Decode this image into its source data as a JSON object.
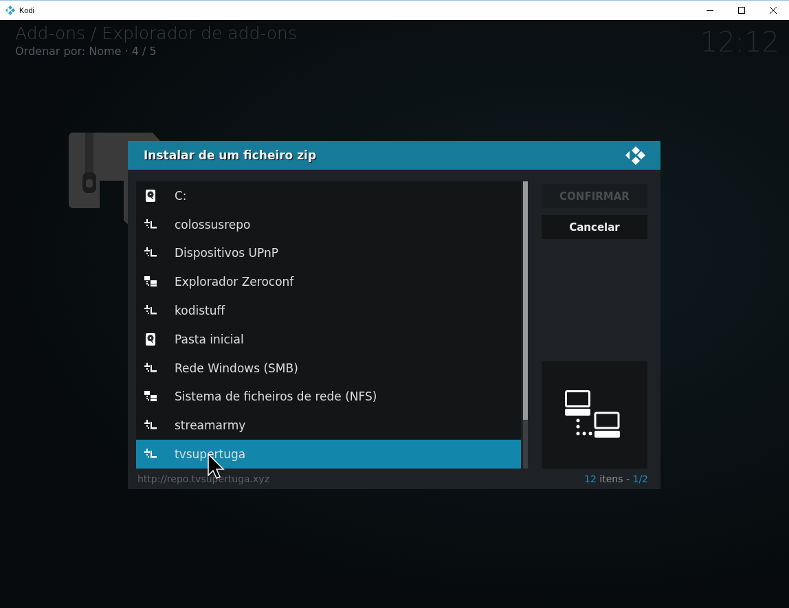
{
  "window": {
    "title": "Kodi"
  },
  "header": {
    "breadcrumb": "Add-ons / Explorador de add-ons",
    "sort_info": "Ordenar por: Nome · 4 / 5",
    "clock": "12:12"
  },
  "dialog": {
    "title": "Instalar de um ficheiro zip",
    "items": [
      {
        "label": "C:",
        "kind": "drive",
        "selected": false
      },
      {
        "label": "colossusrepo",
        "kind": "network",
        "selected": false
      },
      {
        "label": "Dispositivos UPnP",
        "kind": "network",
        "selected": false
      },
      {
        "label": "Explorador Zeroconf",
        "kind": "zeroconf",
        "selected": false
      },
      {
        "label": "kodistuff",
        "kind": "network",
        "selected": false
      },
      {
        "label": "Pasta inicial",
        "kind": "drive",
        "selected": false
      },
      {
        "label": "Rede Windows (SMB)",
        "kind": "network",
        "selected": false
      },
      {
        "label": "Sistema de ficheiros de rede (NFS)",
        "kind": "zeroconf",
        "selected": false
      },
      {
        "label": "streamarmy",
        "kind": "network",
        "selected": false
      },
      {
        "label": "tvsupertuga",
        "kind": "network",
        "selected": true
      }
    ],
    "buttons": [
      {
        "label": "CONFIRMAR",
        "disabled": true
      },
      {
        "label": "Cancelar",
        "disabled": false
      }
    ],
    "path": "http://repo.tvsupertuga.xyz",
    "count": "12",
    "count_unit": "itens -",
    "page": "1/2"
  }
}
